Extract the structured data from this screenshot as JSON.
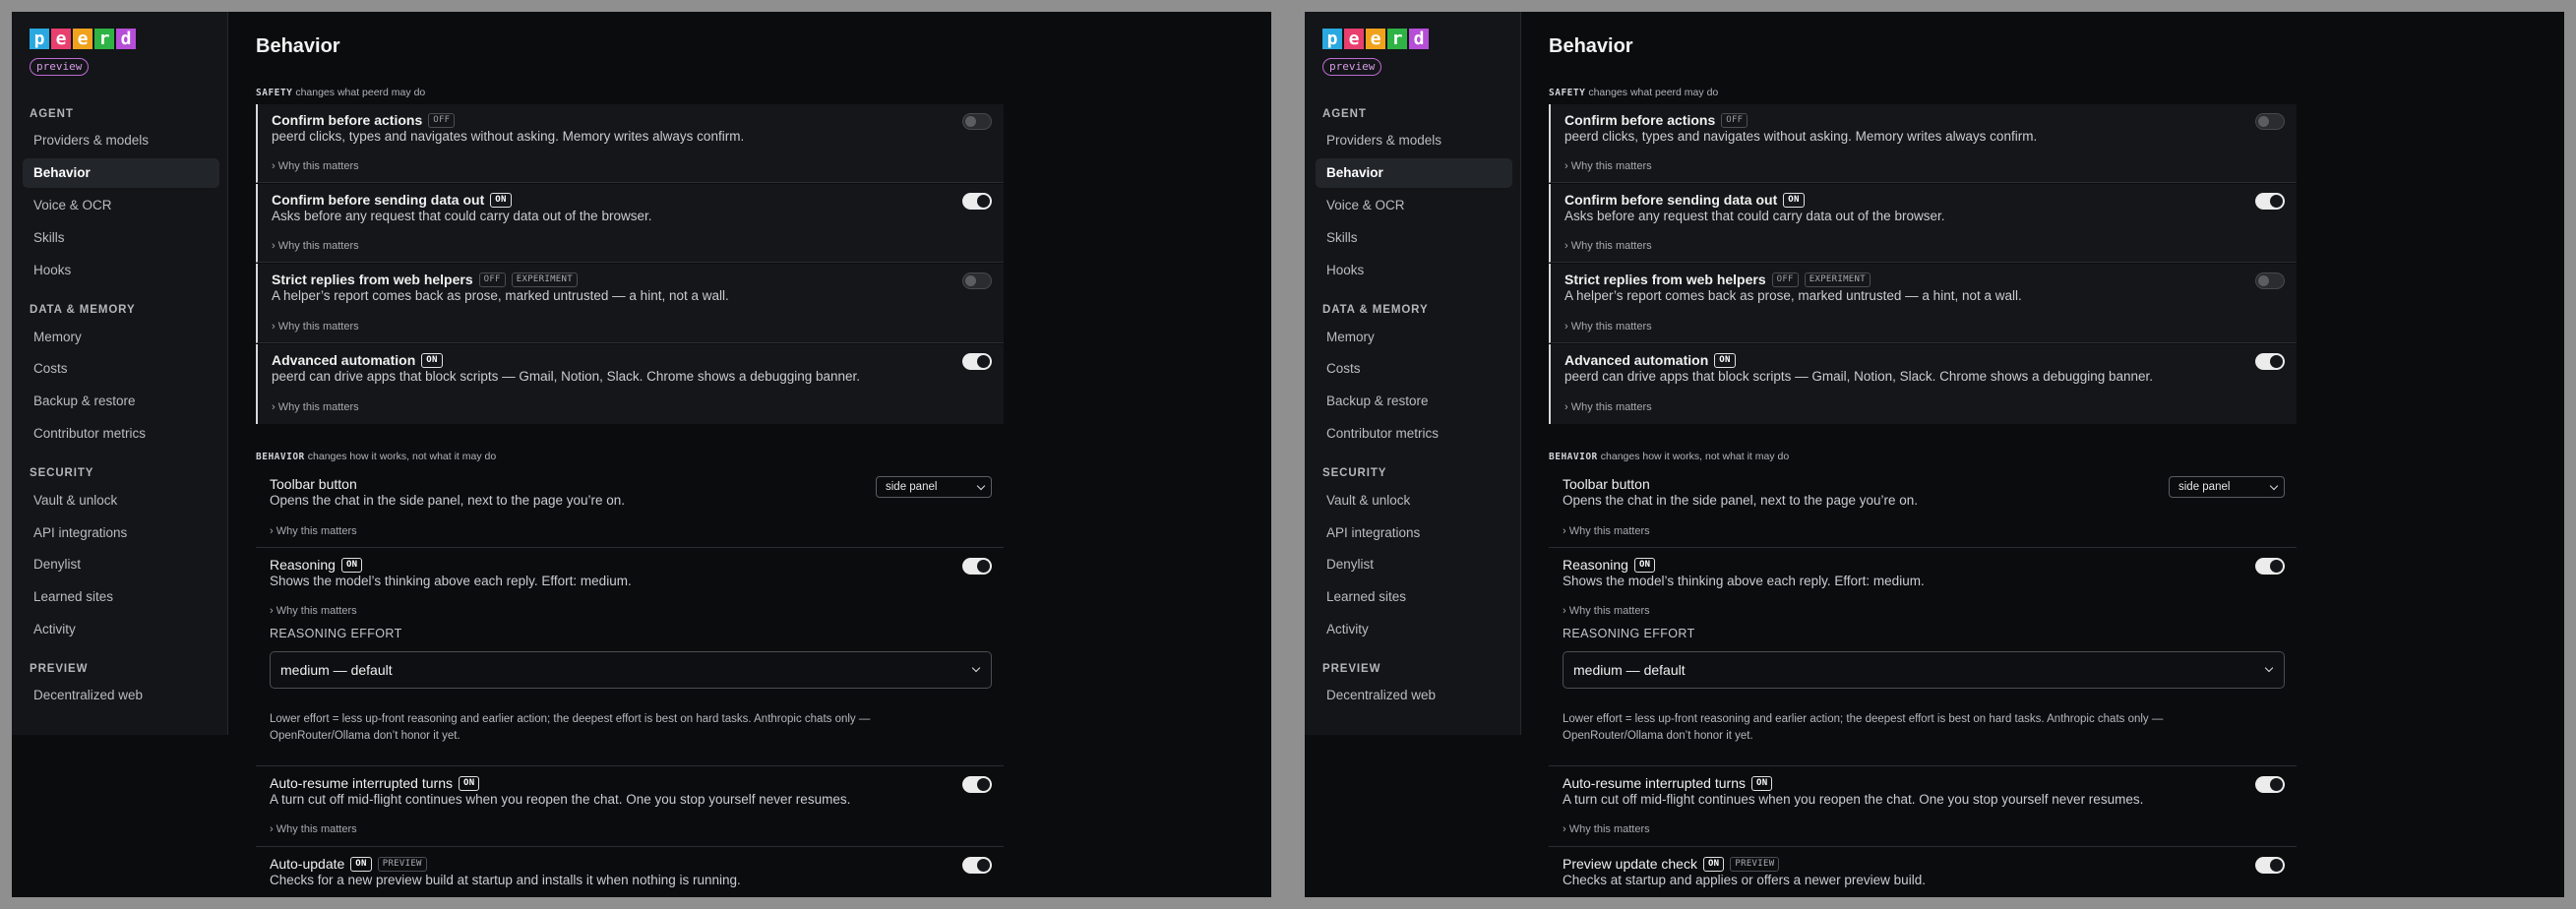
{
  "logo_letters": [
    "p",
    "e",
    "e",
    "r",
    "d"
  ],
  "logo_colors": [
    "#2aa8e0",
    "#e83f6f",
    "#f0a21c",
    "#2fb344",
    "#b64ed8"
  ],
  "preview_badge": "preview",
  "sidebar": {
    "agent": "AGENT",
    "providers": "Providers & models",
    "behavior": "Behavior",
    "voice": "Voice & OCR",
    "skills": "Skills",
    "hooks": "Hooks",
    "data_memory": "DATA & MEMORY",
    "memory": "Memory",
    "costs": "Costs",
    "backup": "Backup & restore",
    "contributor": "Contributor metrics",
    "security": "SECURITY",
    "vault": "Vault & unlock",
    "api": "API integrations",
    "denylist": "Denylist",
    "learned": "Learned sites",
    "activity": "Activity",
    "preview": "PREVIEW",
    "decentralized": "Decentralized web"
  },
  "page_title": "Behavior",
  "why": "› Why this matters",
  "tags": {
    "off": "OFF",
    "on": "ON",
    "experiment": "EXPERIMENT",
    "preview": "PREVIEW"
  },
  "safety": {
    "label": "SAFETY",
    "hint": "changes what peerd may do",
    "confirm_actions": {
      "title": "Confirm before actions",
      "desc": "peerd clicks, types and navigates without asking. Memory writes always confirm."
    },
    "confirm_data": {
      "title": "Confirm before sending data out",
      "desc": "Asks before any request that could carry data out of the browser."
    },
    "strict": {
      "title": "Strict replies from web helpers",
      "desc": "A helper’s report comes back as prose, marked untrusted — a hint, not a wall."
    },
    "automation": {
      "title": "Advanced automation",
      "desc": "peerd can drive apps that block scripts — Gmail, Notion, Slack. Chrome shows a debugging banner."
    }
  },
  "behavior": {
    "label": "BEHAVIOR",
    "hint": "changes how it works, not what it may do",
    "toolbar": {
      "title": "Toolbar button",
      "desc": "Opens the chat in the side panel, next to the page you’re on.",
      "value": "side panel"
    },
    "reasoning": {
      "title": "Reasoning",
      "desc": "Shows the model’s thinking above each reply. Effort: medium.",
      "effort_label": "REASONING EFFORT",
      "effort_value": "medium — default",
      "note": "Lower effort = less up-front reasoning and earlier action; the deepest effort is best on hard tasks. Anthropic chats only — OpenRouter/Ollama don’t honor it yet."
    },
    "auto_resume": {
      "title": "Auto-resume interrupted turns",
      "desc": "A turn cut off mid-flight continues when you reopen the chat. One you stop yourself never resumes."
    }
  },
  "panels": [
    {
      "last_title": "Auto-update",
      "last_desc": "Checks for a new preview build at startup and installs it when nothing is running."
    },
    {
      "last_title": "Preview update check",
      "last_desc": "Checks at startup and applies or offers a newer preview build."
    }
  ]
}
